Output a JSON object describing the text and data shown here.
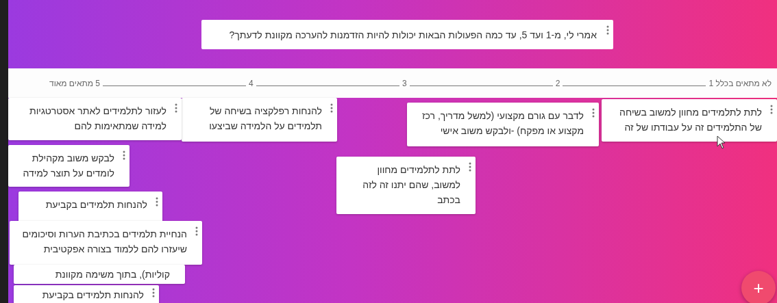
{
  "question": "אמרי לי, מ-1 ועד 5, עד כמה הפעולות הבאות יכולות להיות הזדמנות להערכה מקוונת לדעתך?",
  "scale": [
    "לא מתאים בכלל 1",
    "2",
    "3",
    "4",
    "5 מתאים מאוד"
  ],
  "cards": [
    {
      "text": "לתת לתלמידים מחוון למשוב בשיחה\nשל התלמידים זה על עבודתו של זה"
    },
    {
      "text": "לדבר עם גורם מקצועי (למשל מדריך, רכז\nמקצוע או מפקח) -ולבקש משוב אישי"
    },
    {
      "text": "להנחות רפלקציה בשיחה של\nתלמידים על הלמידה שביצעו"
    },
    {
      "text": "לעזור לתלמידים לאתר אסטרטגיות\nלמידה שמתאימות להם"
    },
    {
      "text": "לבקש משוב מקהילת\nלומדים על תוצר למידה"
    },
    {
      "text": "להנחות תלמידים בקביעת"
    },
    {
      "text": "הנחיית תלמידים בכתיבת הערות וסיכומים\nשיעזרו להם ללמוד בצורה אפקטיבית"
    },
    {
      "text": "קוליות), בתוך משימה מקוונת"
    },
    {
      "text": "להנחות תלמידים בקביעת"
    },
    {
      "text": "לתת לתלמידים מחוון\nלמשוב, שהם יתנו זה לזה\nבכתב"
    }
  ],
  "add_button": "+"
}
